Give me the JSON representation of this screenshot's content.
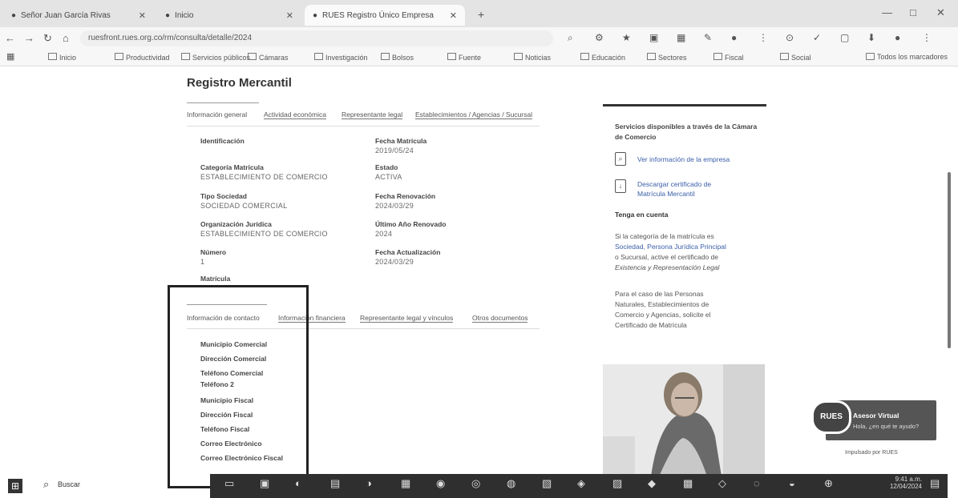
{
  "browser": {
    "tabs": [
      {
        "label": "Señor Juan García Rivas",
        "active": false
      },
      {
        "label": "Inicio",
        "active": false
      },
      {
        "label": "RUES Registro Único Empresa",
        "active": true
      }
    ],
    "new_tab": "+",
    "window_controls": [
      "—",
      "□",
      "✕"
    ],
    "nav": [
      "←",
      "→",
      "↻",
      "⌂"
    ],
    "url": "ruesfront.rues.org.co/rm/consulta/detalle/2024",
    "extension_icons": [
      "⌕",
      "⚙",
      "★",
      "▣",
      "▦",
      "✎",
      "●",
      "⋮",
      "⊙",
      "✓",
      "▢",
      "⬇",
      "●",
      "⋮"
    ],
    "apps_icon": "▦",
    "bookmarks": [
      "Inicio",
      "Productividad",
      "Servicios públicos",
      "Cámaras",
      "Investigación",
      "Bolsos",
      "Fuente",
      "Noticias",
      "Educación",
      "Sectores",
      "Fiscal",
      "Social"
    ],
    "all_bookmarks": "Todos los marcadores"
  },
  "page": {
    "title": "Registro Mercantil",
    "tabs1": [
      "Información general",
      "Actividad económica",
      "Representante legal",
      "Establecimientos / Agencias / Sucursal"
    ],
    "left_col": [
      {
        "label": "Identificación",
        "value": ""
      },
      {
        "label": "Categoría Matrícula",
        "value": "ESTABLECIMIENTO DE COMERCIO"
      },
      {
        "label": "Tipo Sociedad",
        "value": "SOCIEDAD COMERCIAL"
      },
      {
        "label": "Organización Jurídica",
        "value": "ESTABLECIMIENTO DE COMERCIO"
      },
      {
        "label": "Número",
        "value": "1"
      },
      {
        "label": "Matrícula",
        "value": ""
      }
    ],
    "right_col": [
      {
        "label": "Fecha Matrícula",
        "value": "2019/05/24"
      },
      {
        "label": "Estado",
        "value": "ACTIVA"
      },
      {
        "label": "Fecha Renovación",
        "value": "2024/03/29"
      },
      {
        "label": "Último Año Renovado",
        "value": "2024"
      },
      {
        "label": "Fecha Actualización",
        "value": "2024/03/29"
      }
    ],
    "tabs2": [
      "Información de contacto",
      "Información financiera",
      "Representante legal y vínculos",
      "Otros documentos"
    ],
    "contact_items": [
      "Municipio Comercial",
      "Dirección Comercial",
      "Teléfono Comercial",
      "Teléfono 2",
      "Municipio Fiscal",
      "Dirección Fiscal",
      "Teléfono Fiscal",
      "Correo Electrónico",
      "Correo Electrónico Fiscal"
    ]
  },
  "sidebar": {
    "heading": "Servicios disponibles a través de la Cámara de Comercio",
    "services": [
      {
        "icon": "search-doc-icon",
        "label": "Ver información de la empresa"
      },
      {
        "icon": "download-doc-icon",
        "label": "Descargar certificado de Matrícula Mercantil"
      }
    ],
    "subheading": "Tenga en cuenta",
    "para1": [
      "Si la categoría de la matrícula es",
      "Sociedad, Persona Jurídica Principal",
      "o Sucursal, active el certificado de",
      "Existencia y Representación Legal"
    ],
    "para2": [
      "Para el caso de las Personas",
      "Naturales, Establecimientos de",
      "Comercio y Agencias, solicite el",
      "Certificado de Matrícula"
    ]
  },
  "widget": {
    "badge": "RUES",
    "title": "Asesor Virtual",
    "subtitle": "Hola, ¿en qué te ayudo?",
    "below": "Impulsado por RUES"
  },
  "taskbar": {
    "start": "⊞",
    "search_icon": "⌕",
    "search_label": "Buscar",
    "clock": "9:41 a.m.",
    "date": "12/04/2024"
  }
}
